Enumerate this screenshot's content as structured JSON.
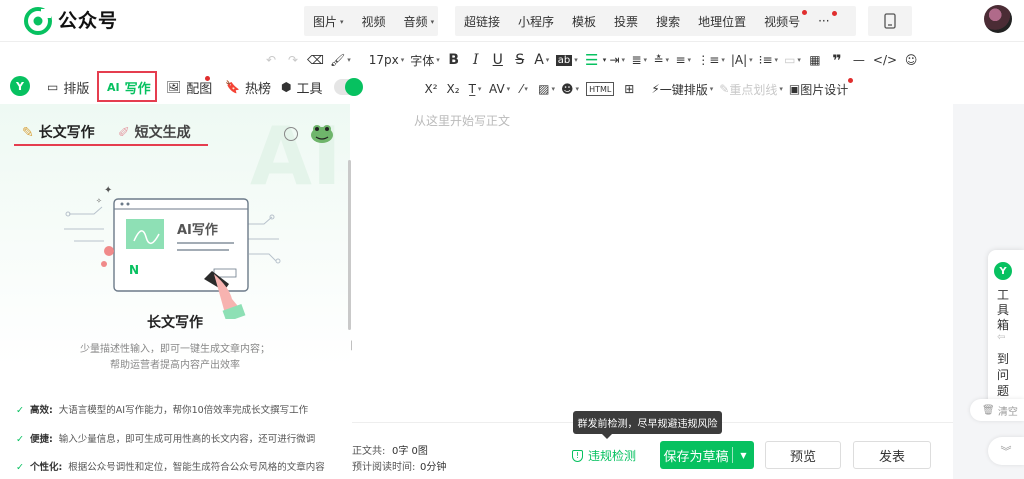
{
  "header": {
    "brand": "公众号",
    "media_items": [
      {
        "label": "图片",
        "caret": "▾"
      },
      {
        "label": "视频",
        "caret": ""
      },
      {
        "label": "音频",
        "caret": "▾"
      }
    ],
    "insert_items": [
      {
        "label": "超链接"
      },
      {
        "label": "小程序"
      },
      {
        "label": "模板"
      },
      {
        "label": "投票"
      },
      {
        "label": "搜索"
      },
      {
        "label": "地理位置"
      },
      {
        "label": "视频号"
      },
      {
        "label": "···"
      }
    ]
  },
  "toolbar1": {
    "font_size": "17px",
    "font_family": "字体",
    "bold": "B",
    "italic": "I",
    "underline": "U",
    "strike": "S",
    "font_color": "A",
    "more": "ab"
  },
  "toolbar2": {
    "superscript": "X²",
    "subscript": "X₂",
    "one_click_layout": "一键排版",
    "highlight": "重点划线",
    "image_design": "图片设计"
  },
  "mode_tabs": [
    {
      "label": "排版",
      "icon": "layout-icon"
    },
    {
      "label": "写作",
      "icon": "ai-write-icon"
    },
    {
      "label": "配图",
      "icon": "image-icon"
    },
    {
      "label": "热榜",
      "icon": "bookmark-icon"
    },
    {
      "label": "工具",
      "icon": "box-icon"
    }
  ],
  "ai_panel": {
    "subtab_long": "长文写作",
    "subtab_short": "短文生成",
    "illustration_title": "AI写作",
    "title": "长文写作",
    "desc1": "少量描述性输入，即可一键生成文章内容；",
    "desc2": "帮助运营者提高内容产出效率",
    "features": [
      {
        "key": "高效:",
        "text": "大语言模型的AI写作能力，帮你10倍效率完成长文撰写工作"
      },
      {
        "key": "便捷:",
        "text": "输入少量信息，即可生成可用性高的长文内容，还可进行微调"
      },
      {
        "key": "个性化:",
        "text": "根据公众号调性和定位，智能生成符合公众号风格的文章内容"
      }
    ]
  },
  "editor": {
    "placeholder": "从这里开始写正文"
  },
  "toolbox": {
    "chars": [
      "工",
      "具",
      "箱",
      "到",
      "问",
      "题"
    ],
    "clear": "清空"
  },
  "bottom": {
    "stat1_label": "正文共:",
    "stat1_value": "0字 0图",
    "stat2_label": "预计阅读时间:",
    "stat2_value": "0分钟",
    "tooltip": "群发前检测，尽早规避违规风险",
    "check": "违规检测",
    "save": "保存为草稿",
    "preview": "预览",
    "publish": "发表"
  },
  "colors": {
    "accent": "#07c160",
    "highlight_box": "#e53d4f",
    "notify": "#e02e2e"
  }
}
